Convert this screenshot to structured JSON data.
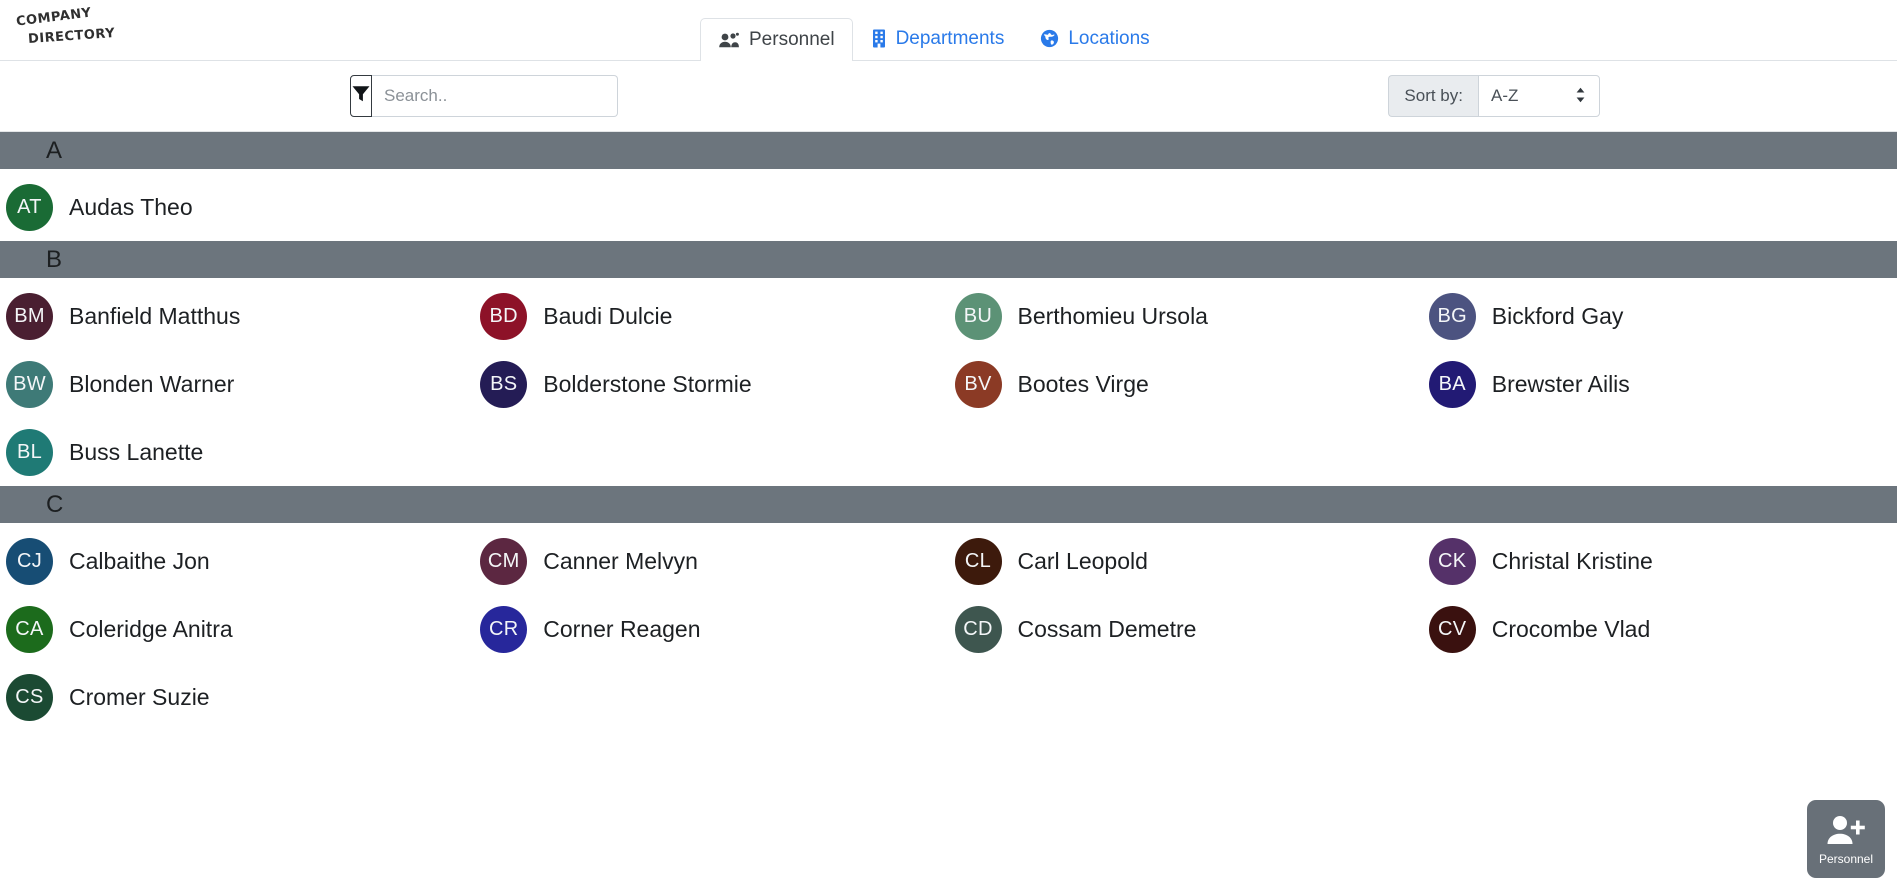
{
  "app": {
    "logo_line1": "COMPANY",
    "logo_line2": "DIRECTORY"
  },
  "tabs": [
    {
      "label": "Personnel",
      "icon": "users-icon",
      "active": true
    },
    {
      "label": "Departments",
      "icon": "building-icon",
      "active": false
    },
    {
      "label": "Locations",
      "icon": "globe-icon",
      "active": false
    }
  ],
  "toolbar": {
    "filter_icon": "funnel-icon",
    "search_placeholder": "Search..",
    "search_value": "",
    "sort_label": "Sort by:",
    "sort_value": "A-Z",
    "sort_options": [
      "A-Z"
    ]
  },
  "fab": {
    "label": "Personnel",
    "icon": "user-plus-icon"
  },
  "colors": {
    "section_header_bg": "#6c757d",
    "tab_link": "#2a7ae9",
    "tab_active_text": "#3f4448",
    "fab_bg": "#687078"
  },
  "sections": [
    {
      "letter": "A",
      "people": [
        {
          "name": "Audas Theo",
          "initials": "AT",
          "color": "#1a6b35"
        }
      ]
    },
    {
      "letter": "B",
      "people": [
        {
          "name": "Banfield Matthus",
          "initials": "BM",
          "color": "#4a1f31"
        },
        {
          "name": "Baudi Dulcie",
          "initials": "BD",
          "color": "#8d1228"
        },
        {
          "name": "Berthomieu Ursola",
          "initials": "BU",
          "color": "#5c9276"
        },
        {
          "name": "Bickford Gay",
          "initials": "BG",
          "color": "#4c5380"
        },
        {
          "name": "Blonden Warner",
          "initials": "BW",
          "color": "#3e7a77"
        },
        {
          "name": "Bolderstone Stormie",
          "initials": "BS",
          "color": "#241c55"
        },
        {
          "name": "Bootes Virge",
          "initials": "BV",
          "color": "#8b3a25"
        },
        {
          "name": "Brewster Ailis",
          "initials": "BA",
          "color": "#221a74"
        },
        {
          "name": "Buss Lanette",
          "initials": "BL",
          "color": "#1f7a75"
        }
      ]
    },
    {
      "letter": "C",
      "people": [
        {
          "name": "Calbaithe Jon",
          "initials": "CJ",
          "color": "#174d74"
        },
        {
          "name": "Canner Melvyn",
          "initials": "CM",
          "color": "#5c2741"
        },
        {
          "name": "Carl Leopold",
          "initials": "CL",
          "color": "#3d1a0c"
        },
        {
          "name": "Christal Kristine",
          "initials": "CK",
          "color": "#553169"
        },
        {
          "name": "Coleridge Anitra",
          "initials": "CA",
          "color": "#1c6b1c"
        },
        {
          "name": "Corner Reagen",
          "initials": "CR",
          "color": "#27279b"
        },
        {
          "name": "Cossam Demetre",
          "initials": "CD",
          "color": "#3e564f"
        },
        {
          "name": "Crocombe Vlad",
          "initials": "CV",
          "color": "#3a110f"
        },
        {
          "name": "Cromer Suzie",
          "initials": "CS",
          "color": "#1b4a33"
        }
      ]
    }
  ]
}
